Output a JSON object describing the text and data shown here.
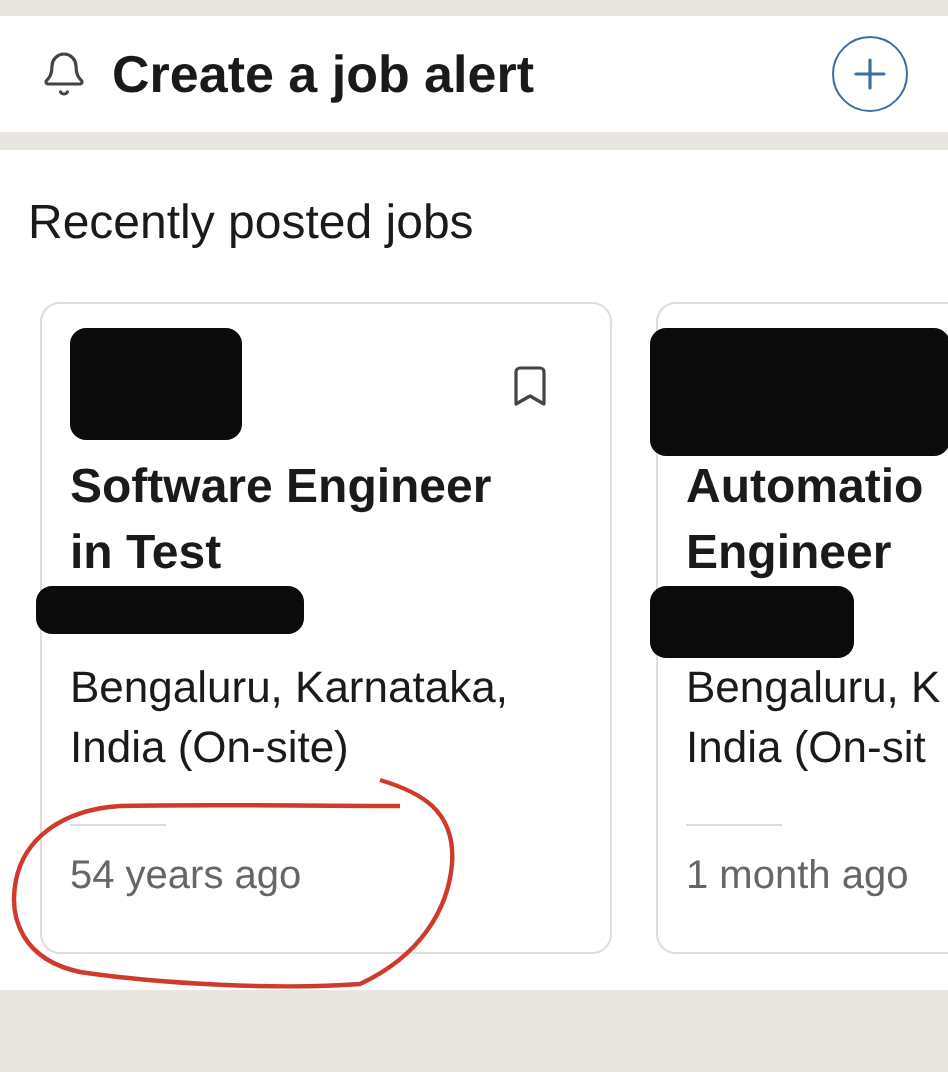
{
  "alert_bar": {
    "title": "Create a job alert"
  },
  "section": {
    "heading": "Recently posted jobs"
  },
  "jobs": [
    {
      "title_lines": [
        "Software Engineer",
        "in Test"
      ],
      "location_lines": [
        "Bengaluru, Karnataka,",
        "India (On-site)"
      ],
      "posted": "54 years ago",
      "bookmark": true
    },
    {
      "title_lines": [
        "Automatio",
        "Engineer"
      ],
      "location_lines": [
        "Bengaluru, K",
        "India (On-sit"
      ],
      "posted": "1 month ago"
    }
  ]
}
